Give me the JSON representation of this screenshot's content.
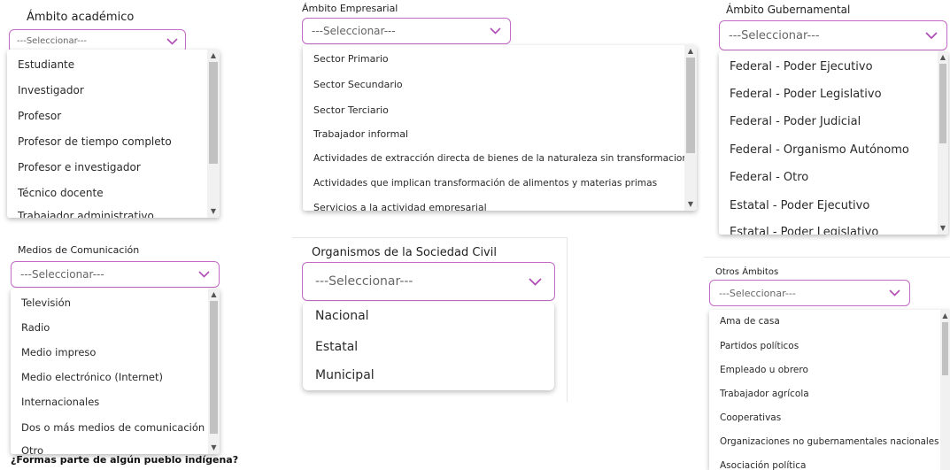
{
  "academico": {
    "label": "Ámbito académico",
    "placeholder": "---Seleccionar---",
    "options": [
      "Estudiante",
      "Investigador",
      "Profesor",
      "Profesor de tiempo completo",
      "Profesor e investigador",
      "Técnico docente",
      "Trabajador administrativo"
    ]
  },
  "empresarial": {
    "label": "Ámbito Empresarial",
    "placeholder": "---Seleccionar---",
    "options": [
      "Sector Primario",
      "Sector Secundario",
      "Sector Terciario",
      "Trabajador informal",
      "Actividades de extracción directa de bienes de la naturaleza sin transformaciones",
      "Actividades que implican transformación de alimentos y materias primas",
      "Servicios a la actividad empresarial"
    ]
  },
  "gubernamental": {
    "label": "Ámbito Gubernamental",
    "placeholder": "---Seleccionar---",
    "options": [
      "Federal - Poder Ejecutivo",
      "Federal - Poder Legislativo",
      "Federal - Poder Judicial",
      "Federal - Organismo Autónomo",
      "Federal - Otro",
      "Estatal - Poder Ejecutivo",
      "Estatal - Poder Legislativo"
    ]
  },
  "medios": {
    "label": "Medios de Comunicación",
    "placeholder": "---Seleccionar---",
    "options": [
      "Televisión",
      "Radio",
      "Medio impreso",
      "Medio electrónico (Internet)",
      "Internacionales",
      "Dos o más medios de comunicación",
      "Otro"
    ],
    "footer_question": "¿Formas parte de algún pueblo indígena?"
  },
  "civil": {
    "label": "Organismos de la Sociedad Civil",
    "placeholder": "---Seleccionar---",
    "options": [
      "Nacional",
      "Estatal",
      "Municipal"
    ]
  },
  "otros": {
    "label": "Otros Ámbitos",
    "placeholder": "---Seleccionar---",
    "options": [
      "Ama de casa",
      "Partidos políticos",
      "Empleado u obrero",
      "Trabajador agrícola",
      "Cooperativas",
      "Organizaciones no gubernamentales nacionales",
      "Asociación política"
    ]
  },
  "colors": {
    "accent_border": "#c26ac6",
    "chevron": "#b04cb6",
    "scroll_thumb": "#c1c1c1"
  }
}
